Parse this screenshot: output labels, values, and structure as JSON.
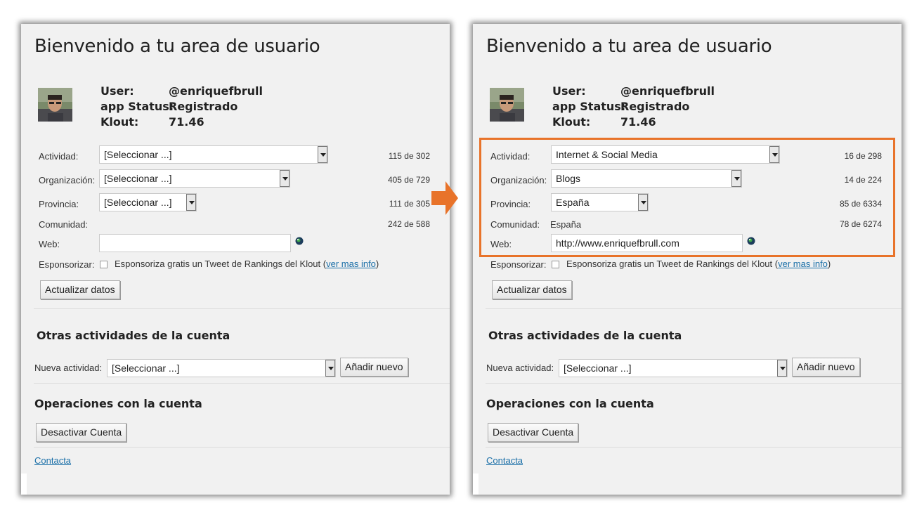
{
  "left": {
    "title": "Bienvenido a tu area de usuario",
    "user": {
      "user_label": "User:",
      "user_value": "@enriquefbrull",
      "status_label": "app Status:",
      "status_value": "Registrado",
      "klout_label": "Klout:",
      "klout_value": "71.46"
    },
    "actividad": {
      "label": "Actividad:",
      "value": "[Seleccionar ...]",
      "count": "115 de 302"
    },
    "organizacion": {
      "label": "Organización:",
      "value": "[Seleccionar ...]",
      "count": "405 de 729"
    },
    "provincia": {
      "label": "Provincia:",
      "value": "[Seleccionar ...]",
      "count": "111 de 305"
    },
    "comunidad": {
      "label": "Comunidad:",
      "value": "",
      "count": "242 de 588"
    },
    "web": {
      "label": "Web:",
      "value": ""
    },
    "sponsor": {
      "label": "Esponsorizar:",
      "text": "Esponsoriza gratis un Tweet de Rankings del Klout (",
      "link": "ver mas info",
      "close": ")"
    },
    "update_button": "Actualizar datos",
    "otras_heading": "Otras actividades de la cuenta",
    "nueva": {
      "label": "Nueva actividad:",
      "value": "[Seleccionar ...]",
      "button": "Añadir nuevo"
    },
    "operaciones_heading": "Operaciones con la cuenta",
    "deactivate_button": "Desactivar Cuenta",
    "contact_link": "Contacta"
  },
  "right": {
    "title": "Bienvenido a tu area de usuario",
    "user": {
      "user_label": "User:",
      "user_value": "@enriquefbrull",
      "status_label": "app Status:",
      "status_value": "Registrado",
      "klout_label": "Klout:",
      "klout_value": "71.46"
    },
    "actividad": {
      "label": "Actividad:",
      "value": "Internet & Social Media",
      "count": "16 de 298"
    },
    "organizacion": {
      "label": "Organización:",
      "value": "Blogs",
      "count": "14 de 224"
    },
    "provincia": {
      "label": "Provincia:",
      "value": "España",
      "count": "85 de 6334"
    },
    "comunidad": {
      "label": "Comunidad:",
      "value": "España",
      "count": "78 de 6274"
    },
    "web": {
      "label": "Web:",
      "value": "http://www.enriquefbrull.com"
    },
    "sponsor": {
      "label": "Esponsorizar:",
      "text": "Esponsoriza gratis un Tweet de Rankings del Klout (",
      "link": "ver mas info",
      "close": ")"
    },
    "update_button": "Actualizar datos",
    "otras_heading": "Otras actividades de la cuenta",
    "nueva": {
      "label": "Nueva actividad:",
      "value": "[Seleccionar ...]",
      "button": "Añadir nuevo"
    },
    "operaciones_heading": "Operaciones con la cuenta",
    "deactivate_button": "Desactivar Cuenta",
    "contact_link": "Contacta"
  },
  "colors": {
    "highlight": "#e8732a",
    "arrow": "#e8732a",
    "link": "#1a6fa8",
    "panel_bg": "#f1f1f1"
  },
  "icons": {
    "arrow": "arrow-right-icon",
    "globe": "globe-icon",
    "dropdown": "chevron-down-icon"
  }
}
